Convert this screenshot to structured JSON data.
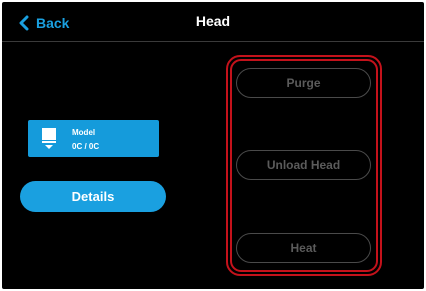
{
  "header": {
    "back_label": "Back",
    "title": "Head"
  },
  "model_card": {
    "icon": "print-head-icon",
    "name": "Model",
    "temperature": "0C / 0C"
  },
  "details_button": {
    "label": "Details"
  },
  "actions": [
    {
      "label": "Purge",
      "enabled": false
    },
    {
      "label": "Unload Head",
      "enabled": false
    },
    {
      "label": "Heat",
      "enabled": false
    }
  ],
  "colors": {
    "accent": "#1aa0e0",
    "card": "#159bdb",
    "background": "#000000",
    "disabled_text": "#5b5b5b",
    "highlight": "#c4121b"
  }
}
